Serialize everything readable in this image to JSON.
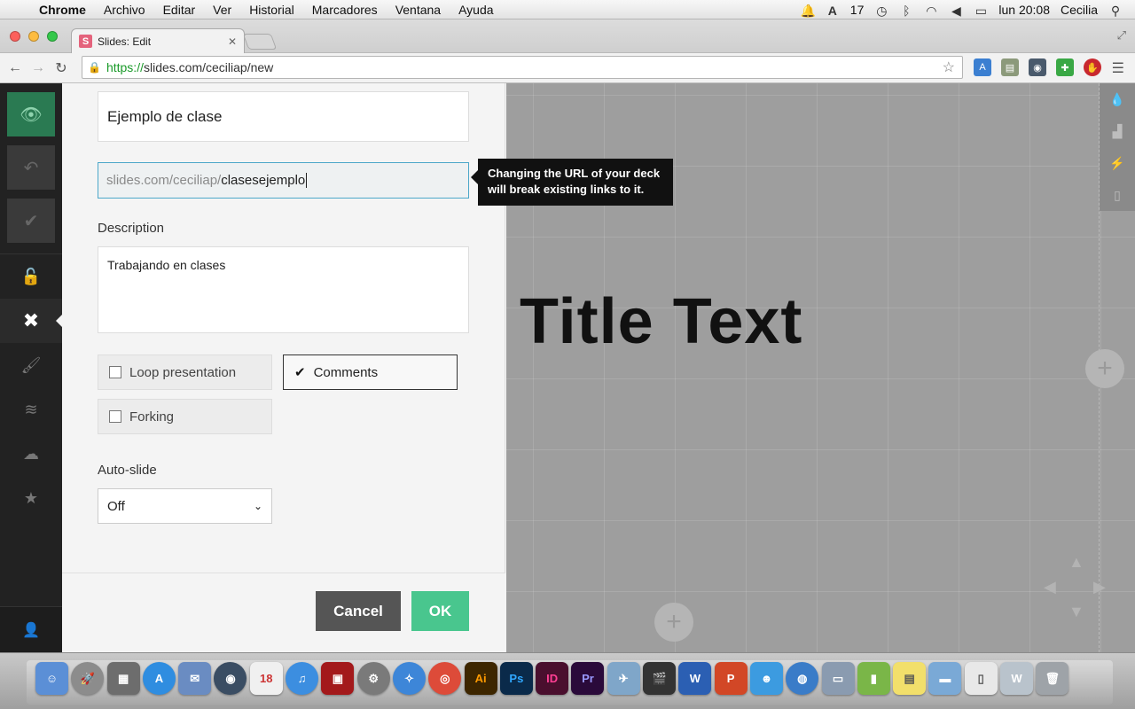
{
  "menubar": {
    "app": "Chrome",
    "items": [
      "Archivo",
      "Editar",
      "Ver",
      "Historial",
      "Marcadores",
      "Ventana",
      "Ayuda"
    ],
    "status": {
      "notifications": "17",
      "clock": "lun 20:08",
      "user": "Cecilia"
    }
  },
  "browser": {
    "tab_title": "Slides: Edit",
    "url_scheme": "https://",
    "url_rest": "slides.com/ceciliap/new"
  },
  "editor": {
    "deck_title": "Ejemplo de clase",
    "url_prefix": "slides.com/ceciliap/",
    "url_slug": "clasesejemplo",
    "tooltip": "Changing the URL of your deck will break existing links to it.",
    "description_label": "Description",
    "description_value": "Trabajando en clases",
    "options": {
      "loop": "Loop presentation",
      "comments": "Comments",
      "forking": "Forking"
    },
    "autoslide_label": "Auto-slide",
    "autoslide_value": "Off",
    "cancel_label": "Cancel",
    "ok_label": "OK"
  },
  "slide": {
    "title": "Title Text"
  },
  "colors": {
    "ok": "#49c68e",
    "preview": "#2a7a52",
    "url_focus_border": "#4ca7c9",
    "canvas": "#9e9e9e"
  },
  "dock": {
    "labels": [
      "Ai",
      "Ps",
      "ID",
      "Pr",
      "W",
      "18"
    ]
  }
}
